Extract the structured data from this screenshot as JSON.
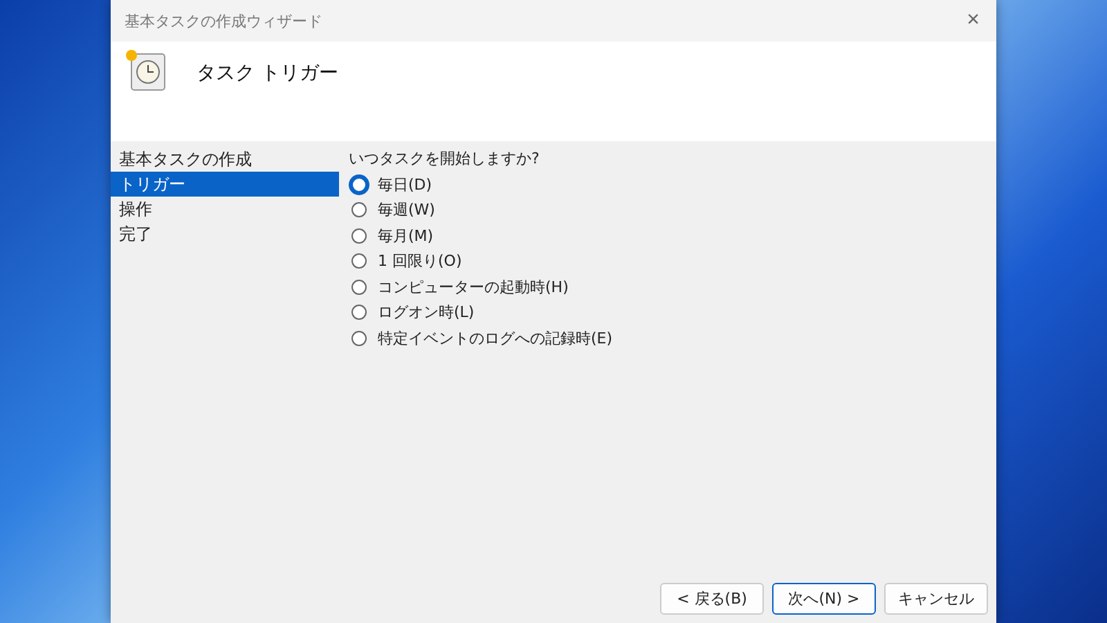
{
  "window": {
    "title": "基本タスクの作成ウィザード",
    "close": "×"
  },
  "header": {
    "title": "タスク トリガー"
  },
  "sidebar": {
    "items": [
      {
        "label": "基本タスクの作成",
        "selected": false
      },
      {
        "label": "トリガー",
        "selected": true
      },
      {
        "label": "操作",
        "selected": false
      },
      {
        "label": "完了",
        "selected": false
      }
    ]
  },
  "question": "いつタスクを開始しますか?",
  "options": [
    {
      "label": "毎日(D)",
      "selected": true
    },
    {
      "label": "毎週(W)",
      "selected": false
    },
    {
      "label": "毎月(M)",
      "selected": false
    },
    {
      "label": "1 回限り(O)",
      "selected": false
    },
    {
      "label": "コンピューターの起動時(H)",
      "selected": false
    },
    {
      "label": "ログオン時(L)",
      "selected": false
    },
    {
      "label": "特定イベントのログへの記録時(E)",
      "selected": false
    }
  ],
  "buttons": [
    {
      "label": "< 戻る(B)",
      "default": false
    },
    {
      "label": "次へ(N) >",
      "default": true
    },
    {
      "label": "キャンセル",
      "default": false
    }
  ]
}
